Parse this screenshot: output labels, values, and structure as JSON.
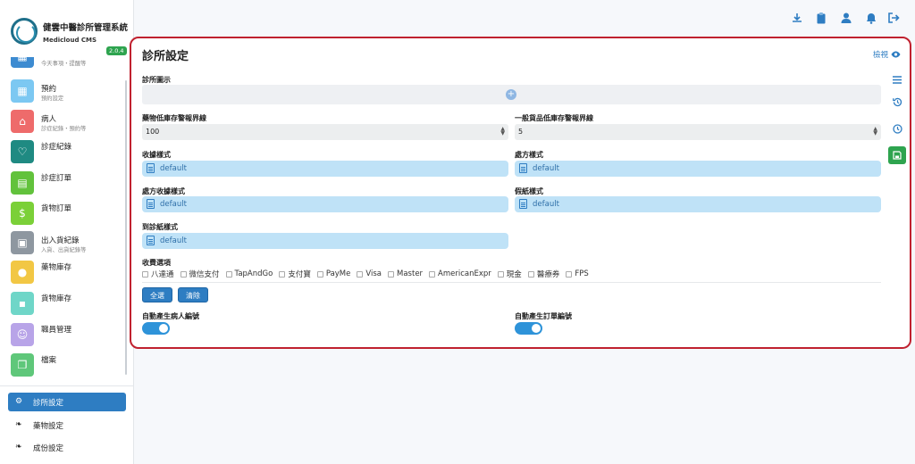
{
  "brand": {
    "title": "健雲中醫診所管理系統",
    "subtitle": "Medicloud CMS",
    "version": "2.0.4"
  },
  "nav": [
    {
      "label": "",
      "sub": "今天事項・提醒等",
      "color": "#3d8bd1",
      "icon": "calendar-icon"
    },
    {
      "label": "預約",
      "sub": "預約設定",
      "color": "#7cc8f2",
      "icon": "calendar-icon"
    },
    {
      "label": "病人",
      "sub": "診症紀錄・預約等",
      "color": "#ee6b6b",
      "icon": "bed-icon"
    },
    {
      "label": "診症紀錄",
      "sub": "",
      "color": "#1f8a82",
      "icon": "stethoscope-icon"
    },
    {
      "label": "診症訂單",
      "sub": "",
      "color": "#62c23c",
      "icon": "document-icon"
    },
    {
      "label": "貨物訂單",
      "sub": "",
      "color": "#7bd038",
      "icon": "receipt-icon"
    },
    {
      "label": "出入貨紀錄",
      "sub": "入貨、出貨紀錄等",
      "color": "#8e97a0",
      "icon": "warehouse-icon"
    },
    {
      "label": "藥物庫存",
      "sub": "",
      "color": "#f2c744",
      "icon": "pills-icon"
    },
    {
      "label": "貨物庫存",
      "sub": "",
      "color": "#6fd6c8",
      "icon": "boxes-icon"
    },
    {
      "label": "職員管理",
      "sub": "",
      "color": "#b8a4e8",
      "icon": "staff-icon"
    },
    {
      "label": "檔案",
      "sub": "",
      "color": "#5fc77a",
      "icon": "files-icon"
    }
  ],
  "bottom_nav": [
    {
      "label": "診所設定",
      "active": true
    },
    {
      "label": "藥物設定",
      "active": false
    },
    {
      "label": "成份設定",
      "active": false
    }
  ],
  "page": {
    "title": "診所設定",
    "preview_label": "檢視",
    "logo_label": "診所圖示",
    "medicine_threshold_label": "藥物低庫存警報界線",
    "medicine_threshold_value": "100",
    "goods_threshold_label": "一般貨品低庫存警報界線",
    "goods_threshold_value": "5",
    "receipt_style_label": "收據樣式",
    "receipt_style_value": "default",
    "prescription_style_label": "處方樣式",
    "prescription_style_value": "default",
    "prescription_receipt_label": "處方收據樣式",
    "prescription_receipt_value": "default",
    "leave_slip_label": "假紙樣式",
    "leave_slip_value": "default",
    "attendance_slip_label": "到診紙樣式",
    "attendance_slip_value": "default",
    "payment_label": "收費選項",
    "payment_options": [
      "八達通",
      "微信支付",
      "TapAndGo",
      "支付寶",
      "PayMe",
      "Visa",
      "Master",
      "AmericanExpr",
      "現金",
      "醫療券",
      "FPS"
    ],
    "select_all_label": "全選",
    "clear_label": "清除",
    "auto_patient_label": "自動產生病人編號",
    "auto_patient_on": true,
    "auto_order_label": "自動產生訂單編號",
    "auto_order_on": true
  },
  "colors": {
    "accent": "#2e7dc2",
    "success": "#2ea44f",
    "highlight": "#c0212f"
  }
}
